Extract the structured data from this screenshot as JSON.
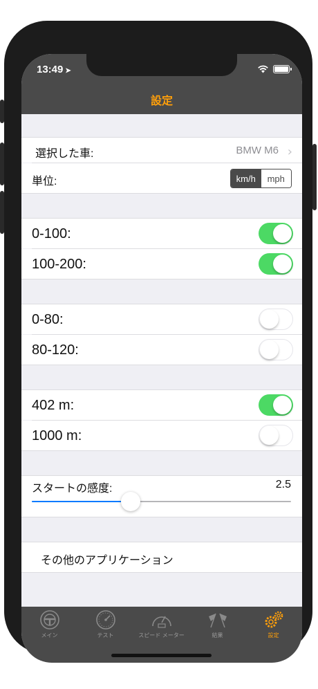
{
  "status_bar": {
    "time": "13:49",
    "location_icon": "location-arrow-icon",
    "wifi_icon": "wifi-icon",
    "battery_icon": "battery-icon"
  },
  "nav": {
    "title": "設定"
  },
  "settings": {
    "car": {
      "label": "選択した車:",
      "value": "BMW M6"
    },
    "unit": {
      "label": "単位:",
      "options": [
        "km/h",
        "mph"
      ],
      "selected": "km/h"
    },
    "toggles": [
      {
        "label": "0-100:",
        "on": true
      },
      {
        "label": "100-200:",
        "on": true
      },
      {
        "label": "0-80:",
        "on": false
      },
      {
        "label": "80-120:",
        "on": false
      },
      {
        "label": "402 m:",
        "on": true
      },
      {
        "label": "1000 m:",
        "on": false
      }
    ],
    "sensitivity": {
      "label": "スタートの感度:",
      "value": "2.5",
      "fraction": 0.38
    },
    "other_apps": {
      "label": "その他のアプリケーション"
    }
  },
  "tabbar": {
    "items": [
      {
        "label": "メイン",
        "icon": "steering-wheel-icon",
        "active": false
      },
      {
        "label": "テスト",
        "icon": "gauge-icon",
        "active": false
      },
      {
        "label": "スピード メーター",
        "icon": "speedometer-icon",
        "active": false
      },
      {
        "label": "結果",
        "icon": "checkered-flags-icon",
        "active": false
      },
      {
        "label": "設定",
        "icon": "gears-icon",
        "active": true
      }
    ]
  },
  "colors": {
    "accent": "#ff9f0a",
    "bar": "#4a4a4a",
    "switch_on": "#4cd964",
    "slider": "#007aff"
  }
}
